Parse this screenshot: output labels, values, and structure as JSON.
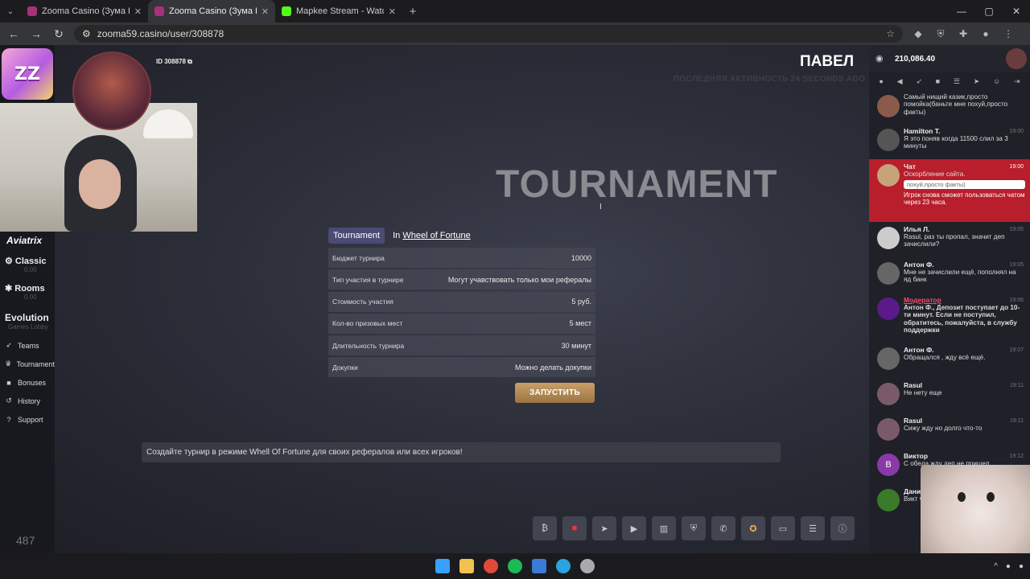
{
  "browser": {
    "tabs": [
      {
        "title": "Zooma Casino (Зума Казин",
        "active": false
      },
      {
        "title": "Zooma Casino (Зума Казино) о",
        "active": true
      },
      {
        "title": "Мaрkee Stream - Watch Live о",
        "active": false
      }
    ],
    "new_tab": "+",
    "url": "zooma59.casino/user/308878",
    "window_controls": [
      "—",
      "▢",
      "✕"
    ]
  },
  "sidebar": {
    "logo_text": "ZZ",
    "aviatrix": "Aviatrix",
    "games": [
      {
        "label": "Classic",
        "sub": "0.00"
      },
      {
        "label": "Rooms",
        "sub": "0.00"
      },
      {
        "label": "Evolution",
        "sub": "Games Lobby"
      }
    ],
    "nav": [
      {
        "label": "Teams",
        "icon": "rocket-icon"
      },
      {
        "label": "Tournament",
        "icon": "trophy-icon"
      },
      {
        "label": "Bonuses",
        "icon": "gift-icon"
      },
      {
        "label": "History",
        "icon": "history-icon"
      },
      {
        "label": "Support",
        "icon": "help-icon"
      }
    ],
    "online_count": "487"
  },
  "profile": {
    "id": "ID 308878",
    "name": "ПАВЕЛ",
    "last_active": "ПОСЛЕДНЯЯ АКТИВНОСТЬ 24 SECONDS AGO"
  },
  "hero_title": "TOURNAMENT",
  "tournament": {
    "tab_label": "Tournament",
    "in_label": "In",
    "game_label": "Wheel of Fortune",
    "rows": [
      {
        "label": "Бюджет турнира",
        "value": "10000"
      },
      {
        "label": "Тип участия в турнире",
        "value": "Могут учавствовать только мои рефералы"
      },
      {
        "label": "Стоимость участия",
        "value": "5 руб."
      },
      {
        "label": "Кол-во призовых мест",
        "value": "5 мест"
      },
      {
        "label": "Длительность турнира",
        "value": "30 минут"
      },
      {
        "label": "Докупки",
        "value": "Можно делать докупки"
      }
    ],
    "launch_button": "ЗАПУСТИТЬ"
  },
  "info_banner": "Создайте турнир в режиме Whell Of Fortune для своих рефералов или всех игроков!",
  "bottom_icons": [
    "bitcoin-icon",
    "gift-icon",
    "telegram-icon",
    "youtube-icon",
    "stats-icon",
    "shield-icon",
    "phone-icon",
    "bonus-icon",
    "wallet-icon",
    "settings-icon",
    "info-icon"
  ],
  "chat": {
    "balance": "210,086.40",
    "messages": [
      {
        "name": "",
        "time": "",
        "text": "Самый нищий казик,просто помойка(баньте мне похуй,просто факты)",
        "avatar_color": "#8a5a4a"
      },
      {
        "name": "Hamilton T.",
        "time": "19:00",
        "text": "Я это поняв когда 11500 слил за 3 минуты",
        "avatar_color": "#555"
      },
      {
        "name": "Чат",
        "time": "19:00",
        "text": "Оскорбление сайта.",
        "alert": true,
        "quote": "похуй,просто факты)",
        "note": "Игрок снова сможет пользоваться чатом через 23 часа.",
        "avatar_color": "#c8a27a"
      },
      {
        "name": "Илья Л.",
        "time": "19:05",
        "text": "Rasul, раз ты пропал, значит деп зачислили?",
        "avatar_color": "#ccc"
      },
      {
        "name": "Антон Ф.",
        "time": "19:05",
        "text": "Мне не зачислили ещё, пополнял на яд банк",
        "avatar_color": "#666"
      },
      {
        "name": "Модератор",
        "time": "19:06",
        "text": "Антон Ф., Депозит поступает до 10-ти минут. Если не поступил, обратитесь, пожалуйста, в службу поддержки",
        "moderator": true,
        "avatar_color": "#5a1a8a"
      },
      {
        "name": "Антон Ф.",
        "time": "19:07",
        "text": "Обращался , жду всё ещё.",
        "avatar_color": "#666"
      },
      {
        "name": "Rasul",
        "time": "19:11",
        "text": "Не нету еще",
        "avatar_color": "#7a5a6a"
      },
      {
        "name": "Rasul",
        "time": "19:11",
        "text": "Сижу жду но долго что-то",
        "avatar_color": "#7a5a6a"
      },
      {
        "name": "Виктор",
        "time": "19:12",
        "text": "С обеда жду деп не пришел",
        "avatar_color": "#8a3aa8",
        "initial": "B"
      },
      {
        "name": "Дани",
        "time": "",
        "text": "Викт чере",
        "avatar_color": "#3a7a2a"
      }
    ]
  },
  "taskbar_icons": [
    "windows-icon",
    "folder-icon",
    "chrome-icon",
    "spotify-icon",
    "app-icon",
    "telegram-icon",
    "steam-icon"
  ]
}
